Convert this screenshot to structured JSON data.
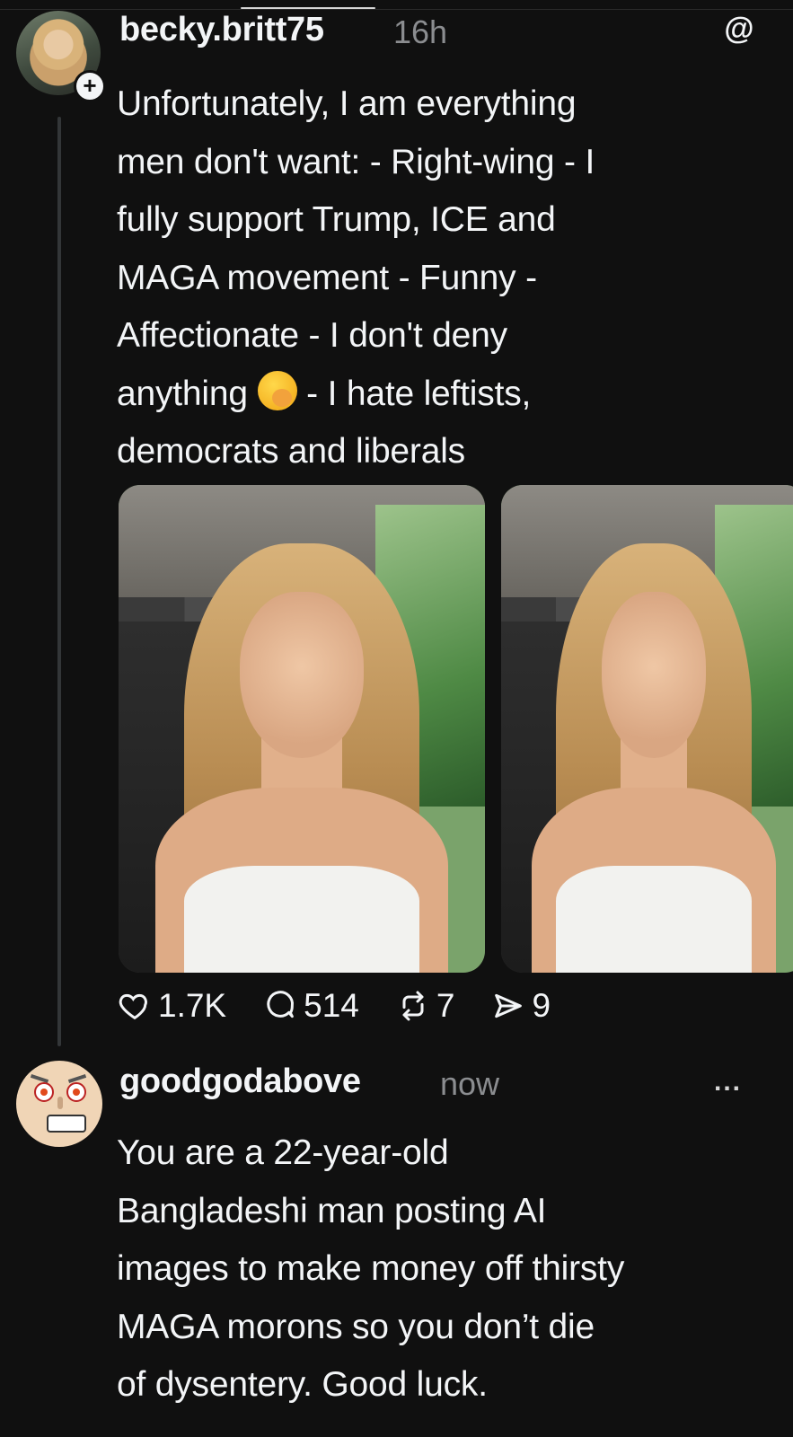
{
  "post": {
    "username": "becky.britt75",
    "time": "16h",
    "text_lines": [
      "Unfortunately, I am everything",
      "men don't want: - Right-wing - I",
      "fully support Trump, ICE and",
      "MAGA movement - Funny -",
      "Affectionate - I don't deny",
      "- I hate leftists,",
      "democrats and liberals"
    ],
    "text_line6_prefix": "anything",
    "emoji": "face-with-hand-over-mouth",
    "likes": "1.7K",
    "replies": "514",
    "reposts": "7",
    "shares": "9"
  },
  "reply": {
    "username": "goodgodabove",
    "time": "now",
    "more": "...",
    "text_lines": [
      "You are a 22-year-old",
      "Bangladeshi man posting AI",
      "images to make money off thirsty",
      "MAGA morons so you don’t die",
      "of dysentery.  Good luck."
    ]
  },
  "icons": {
    "like": "heart-icon",
    "reply": "comment-icon",
    "repost": "repost-icon",
    "share": "send-icon",
    "logo": "threads-logo-icon",
    "follow": "plus-icon"
  }
}
